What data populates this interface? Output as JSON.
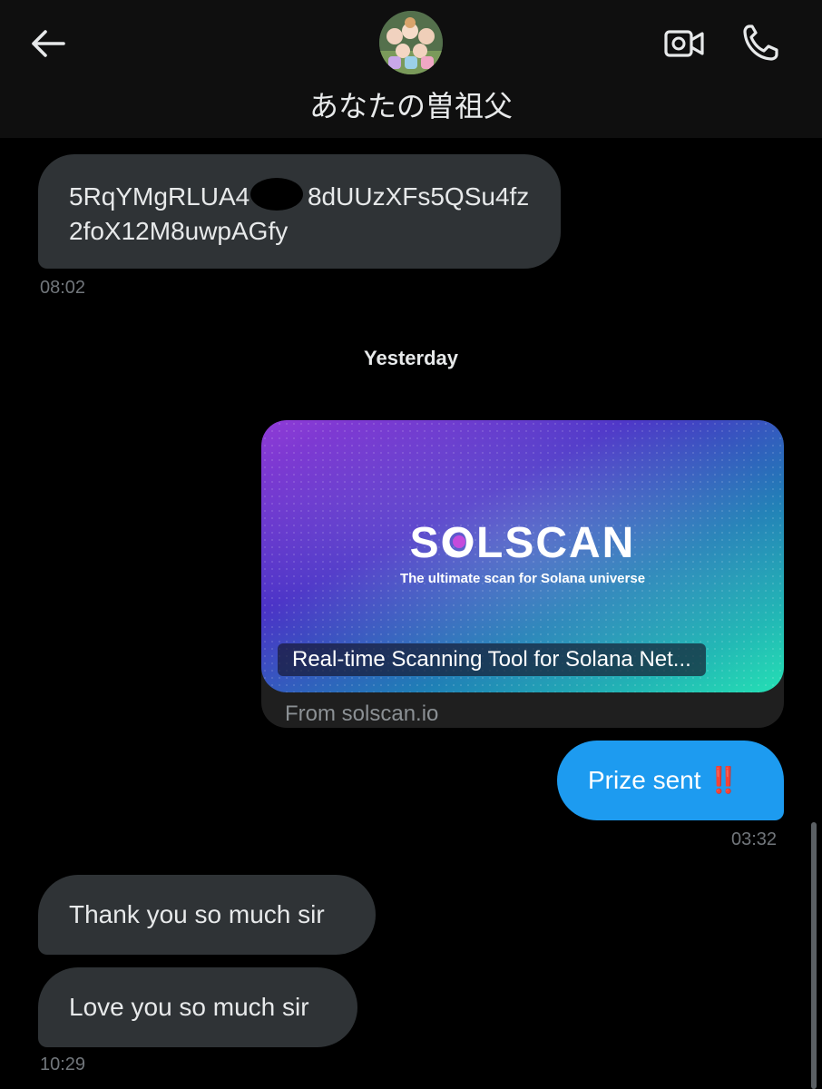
{
  "header": {
    "title": "あなたの曽祖父",
    "back_icon": "arrow-left-icon",
    "video_icon": "video-camera-icon",
    "call_icon": "phone-icon"
  },
  "messages": {
    "address": {
      "text": "5RqYMgRLUA4   8dUUzXFs5QSu4fz2foX12M8uwpAGfy",
      "time": "08:02"
    },
    "date_separator": "Yesterday",
    "link_card": {
      "brand": "SOLSCAN",
      "tagline": "The ultimate scan for Solana universe",
      "title": "Real-time Scanning Tool for Solana Net...",
      "source": "From solscan.io"
    },
    "prize": {
      "text": "Prize sent",
      "emoji": "‼️",
      "time": "03:32"
    },
    "thanks": {
      "text": "Thank you so much sir"
    },
    "love": {
      "text": "Love you so much sir",
      "time": "10:29"
    }
  },
  "colors": {
    "background": "#000000",
    "incoming_bubble": "#2f3336",
    "outgoing_bubble": "#1d9bf0",
    "muted_text": "#71767b"
  }
}
